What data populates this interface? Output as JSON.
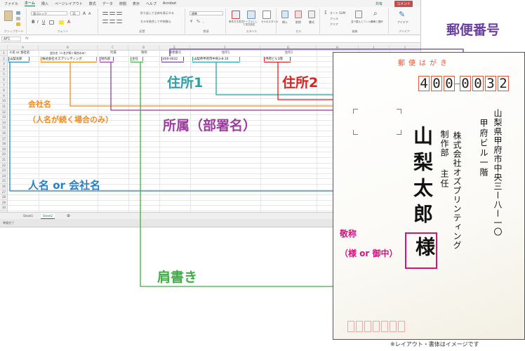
{
  "excel": {
    "menu_tabs": [
      "ファイル",
      "ホーム",
      "挿入",
      "ページレイアウト",
      "数式",
      "データ",
      "校閲",
      "表示",
      "ヘルプ",
      "Acrobat"
    ],
    "active_tab": "ホーム",
    "share_label": "共有",
    "comment_label": "コメント",
    "ribbon": {
      "font_name": "游ゴシック",
      "font_size": "11",
      "wrap_text": "折り返して全体を表示する",
      "merge_center": "セルを結合して中央揃え",
      "number_format": "標準",
      "cond_format": "条件付き書式",
      "table_format": "テーブルとして書式設定",
      "cell_style": "セルのスタイル",
      "insert": "挿入",
      "delete": "削除",
      "format": "書式",
      "autosum": "オート SUM",
      "fill": "フィル",
      "clear": "クリア",
      "sort_filter": "並べ替えとフィルター",
      "find_select": "検索と選択",
      "ideas": "アイデア",
      "groups": [
        "クリップボード",
        "フォント",
        "配置",
        "数値",
        "スタイル",
        "セル",
        "編集",
        "アイデア"
      ]
    },
    "name_box": "AF1",
    "fx": "fx",
    "columns": [
      "A",
      "B",
      "C",
      "D",
      "E",
      "F",
      "G",
      "H",
      "I",
      "J"
    ],
    "rows": [
      "1",
      "2",
      "3",
      "4",
      "5",
      "6",
      "7",
      "8",
      "9",
      "10",
      "11",
      "12",
      "13",
      "14",
      "15",
      "16",
      "17",
      "18",
      "19",
      "20",
      "21",
      "22",
      "23",
      "24",
      "25",
      "26",
      "27",
      "28",
      "29",
      "30"
    ],
    "header_row": {
      "a": "人名 or 会社名",
      "b": "会社名（人名が続く場合のみ）",
      "c": "所属",
      "d": "敬称",
      "e": "郵便番号",
      "f": "住所1",
      "g": "住所2"
    },
    "data_row": {
      "a": "山梨太郎",
      "b": "株式会社オズプリンティング",
      "c": "制作部",
      "d": "主任",
      "e": "400-0032",
      "f": "山梨県甲府市中央3-8-10",
      "g": "甲府ビル1階"
    },
    "sheet_tabs": [
      "Sheet1",
      "Sheet2"
    ],
    "active_sheet": "Sheet2",
    "status": "準備完了"
  },
  "postcard": {
    "title": "郵便はがき",
    "zip_digits": [
      "4",
      "0",
      "0",
      "0",
      "0",
      "3",
      "2"
    ],
    "address1": "山梨県甲府市中央三ー八ー一〇",
    "address2": "甲府ビル一階",
    "company": "株式会社オズプリンティング",
    "department": "制作部",
    "title_position": "主任",
    "name": "山梨太郎",
    "honorific": "様"
  },
  "annotations": {
    "postal": "郵便番号",
    "address1": "住所1",
    "address2": "住所2",
    "company": "会社名",
    "company_sub": "（人名が続く場合のみ）",
    "affiliation": "所属（部署名）",
    "name": "人名 or 会社名",
    "honorific": "敬称",
    "honorific_sub": "（様 or 御中）",
    "title_label": "肩書き"
  },
  "note": "※レイアウト・書体はイメージです",
  "colors": {
    "name": "#2a7fc1",
    "company": "#ef8a1f",
    "affiliation": "#9b3d9e",
    "title": "#3fae45",
    "postal": "#6a3fa0",
    "address1": "#2ba0a8",
    "address2": "#e02020",
    "honorific": "#d0157d"
  }
}
